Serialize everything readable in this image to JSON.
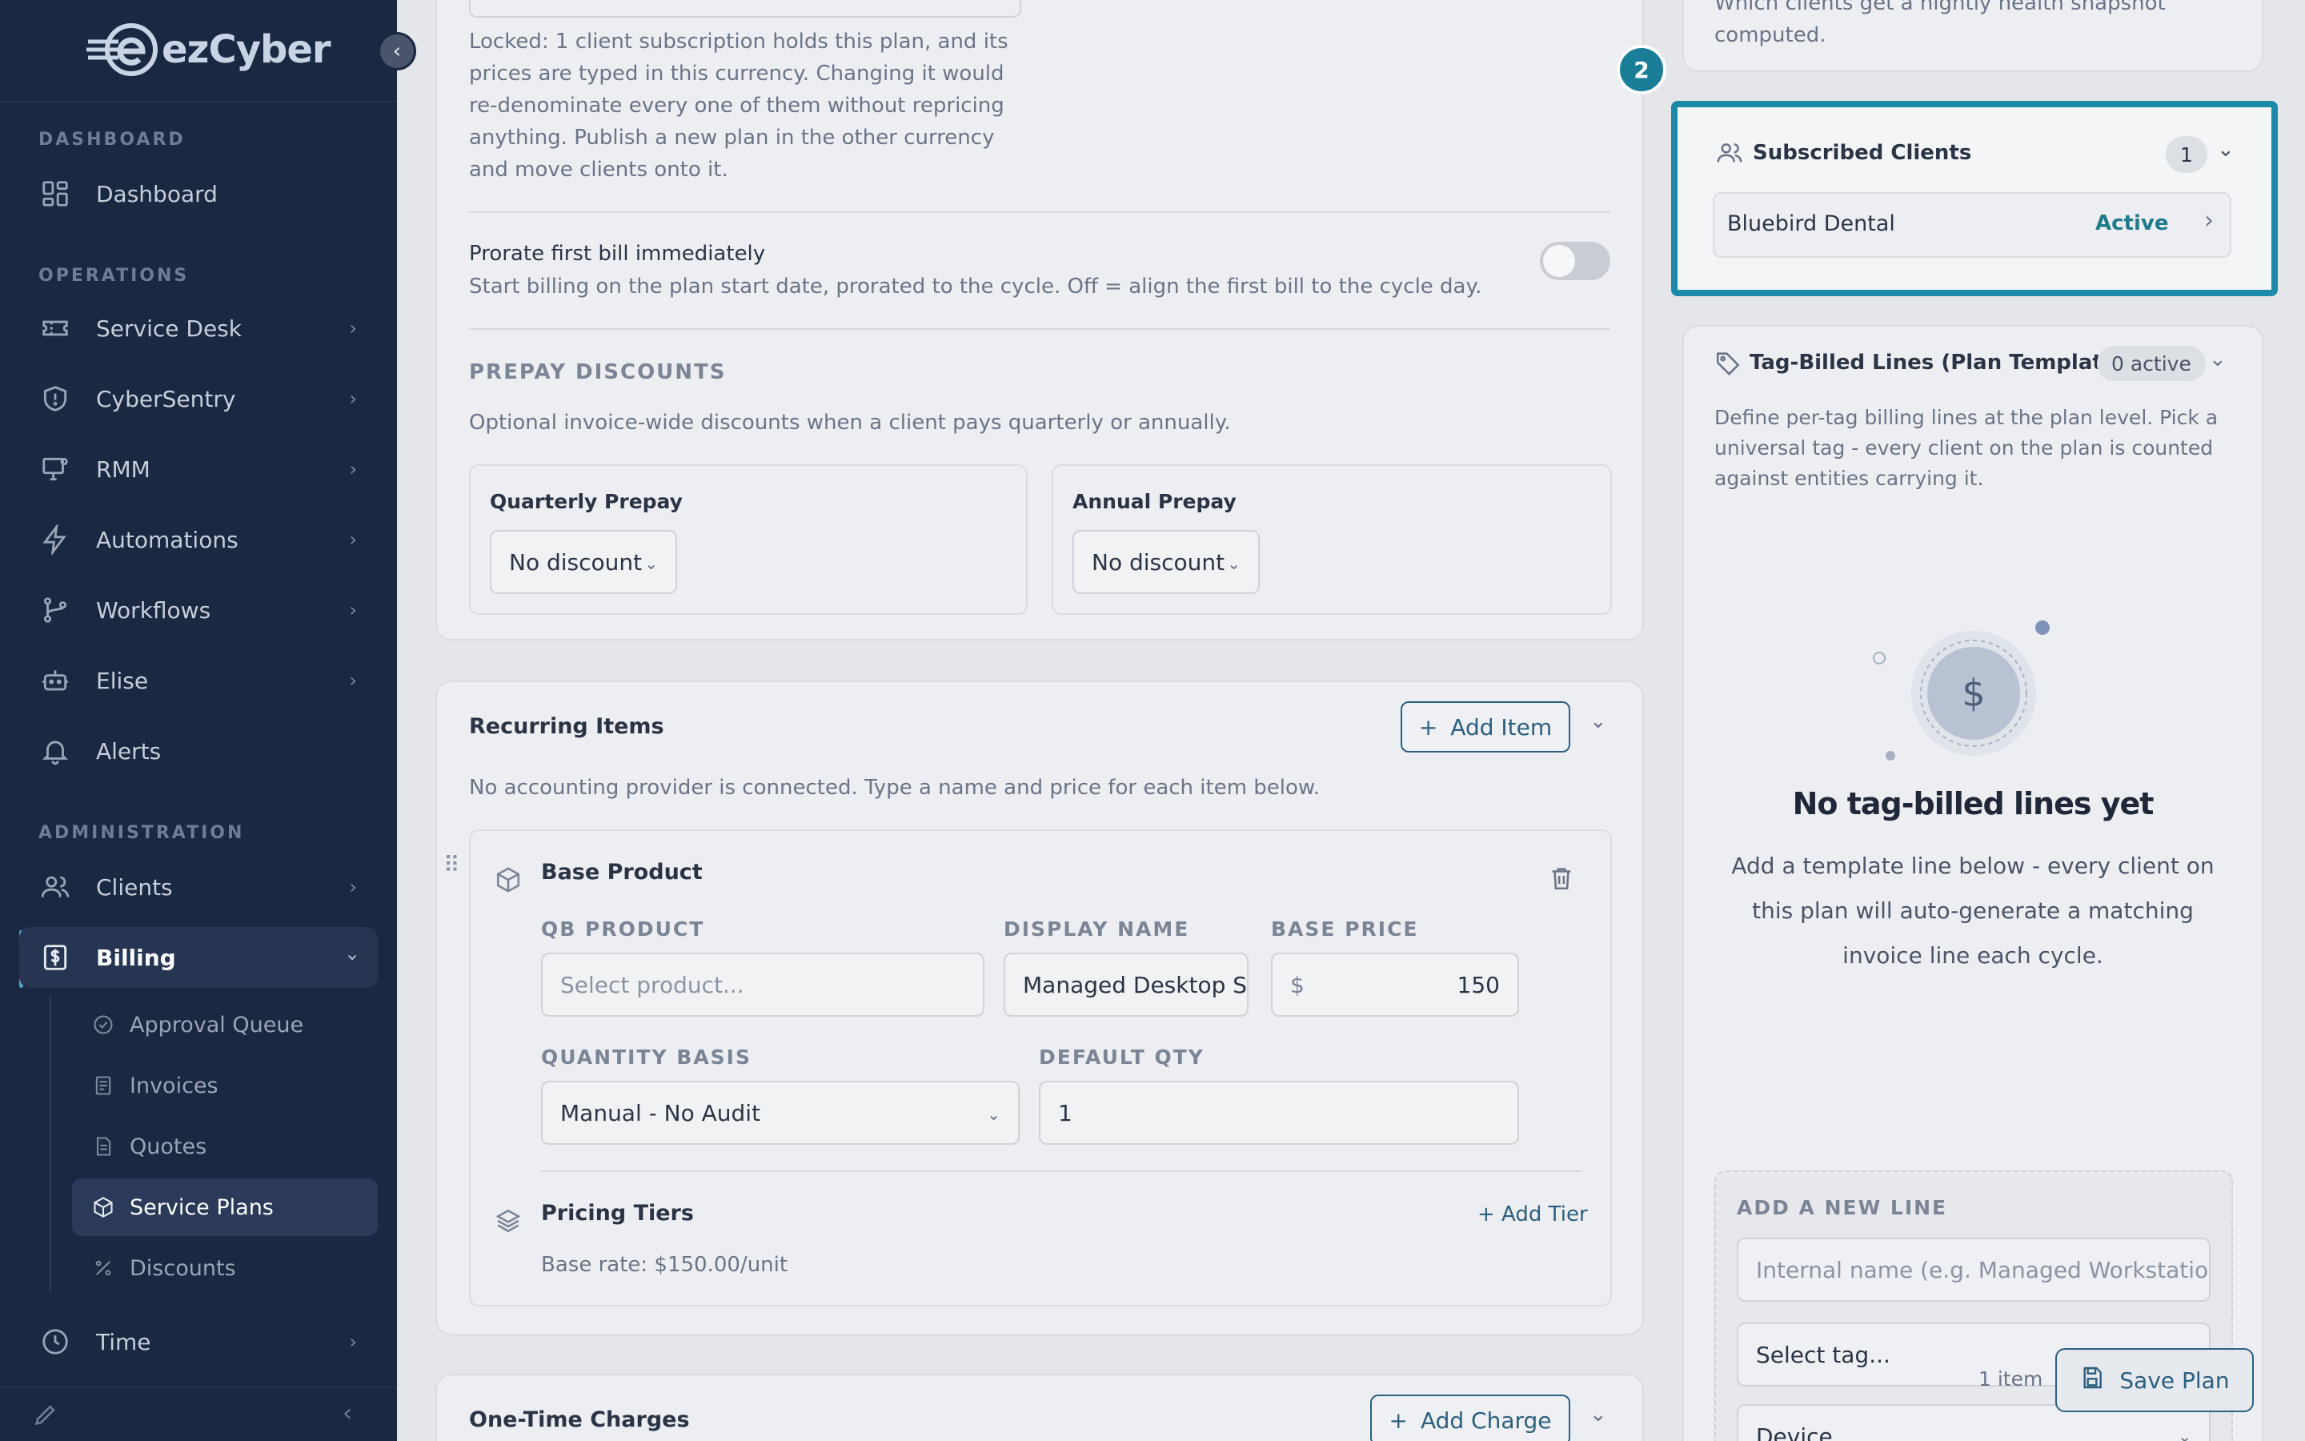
{
  "brand": {
    "name": "ezCyber"
  },
  "sidebar": {
    "sections": {
      "dashboard": "DASHBOARD",
      "operations": "OPERATIONS",
      "administration": "ADMINISTRATION"
    },
    "items": [
      {
        "label": "Dashboard",
        "icon": "grid-icon"
      },
      {
        "label": "Service Desk",
        "icon": "ticket-icon"
      },
      {
        "label": "CyberSentry",
        "icon": "shield-icon"
      },
      {
        "label": "RMM",
        "icon": "monitor-icon"
      },
      {
        "label": "Automations",
        "icon": "bolt-icon"
      },
      {
        "label": "Workflows",
        "icon": "workflow-icon"
      },
      {
        "label": "Elise",
        "icon": "robot-icon"
      },
      {
        "label": "Alerts",
        "icon": "bell-icon"
      },
      {
        "label": "Clients",
        "icon": "users-icon"
      },
      {
        "label": "Billing",
        "icon": "billing-icon"
      },
      {
        "label": "Time",
        "icon": "clock-icon"
      }
    ],
    "billing_sub": [
      {
        "label": "Approval Queue"
      },
      {
        "label": "Invoices"
      },
      {
        "label": "Quotes"
      },
      {
        "label": "Service Plans"
      },
      {
        "label": "Discounts"
      }
    ]
  },
  "currency_note": "Locked: 1 client subscription holds this plan, and its prices are typed in this currency. Changing it would re-denominate every one of them without repricing anything. Publish a new plan in the other currency and move clients onto it.",
  "prorate": {
    "title": "Prorate first bill immediately",
    "desc": "Start billing on the plan start date, prorated to the cycle. Off = align the first bill to the cycle day."
  },
  "prepay": {
    "heading": "PREPAY DISCOUNTS",
    "desc": "Optional invoice-wide discounts when a client pays quarterly or annually.",
    "quarterly_label": "Quarterly Prepay",
    "quarterly_value": "No discount",
    "annual_label": "Annual Prepay",
    "annual_value": "No discount"
  },
  "recurring": {
    "title": "Recurring Items",
    "add_label": "Add Item",
    "note": "No accounting provider is connected. Type a name and price for each item below.",
    "item": {
      "title": "Base Product",
      "qb_label": "QB PRODUCT",
      "qb_placeholder": "Select product...",
      "display_label": "DISPLAY NAME",
      "display_value": "Managed Desktop Su",
      "price_label": "BASE PRICE",
      "currency": "$",
      "price_value": "150",
      "qty_basis_label": "QUANTITY BASIS",
      "qty_basis_value": "Manual - No Audit",
      "default_qty_label": "DEFAULT QTY",
      "default_qty_value": "1",
      "tiers_title": "Pricing Tiers",
      "add_tier": "+ Add Tier",
      "base_rate": "Base rate: $150.00/unit"
    }
  },
  "one_time": {
    "title": "One-Time Charges",
    "add_label": "Add Charge"
  },
  "right": {
    "top_note": "Which clients get a nightly health snapshot computed.",
    "step_badge": "2",
    "subscribed": {
      "title": "Subscribed Clients",
      "count": "1",
      "client": "Bluebird Dental",
      "status": "Active"
    },
    "tag_lines": {
      "title": "Tag-Billed Lines (Plan Template)",
      "badge": "0 active",
      "desc": "Define per-tag billing lines at the plan level. Pick a universal tag - every client on the plan is counted against entities carrying it.",
      "empty_title": "No tag-billed lines yet",
      "empty_desc": "Add a template line below - every client on this plan will auto-generate a matching invoice line each cycle.",
      "add_heading": "ADD A NEW LINE",
      "name_placeholder": "Internal name (e.g. Managed Workstation)",
      "tag_placeholder": "Select tag...",
      "entity_value": "Device"
    },
    "footer": {
      "count": "1 item",
      "save_label": "Save Plan"
    }
  },
  "colors": {
    "sidebar": "#1b2841",
    "accent": "#1b8aa6",
    "primary": "#2d5f80",
    "active_text": "#1f7a8c"
  }
}
